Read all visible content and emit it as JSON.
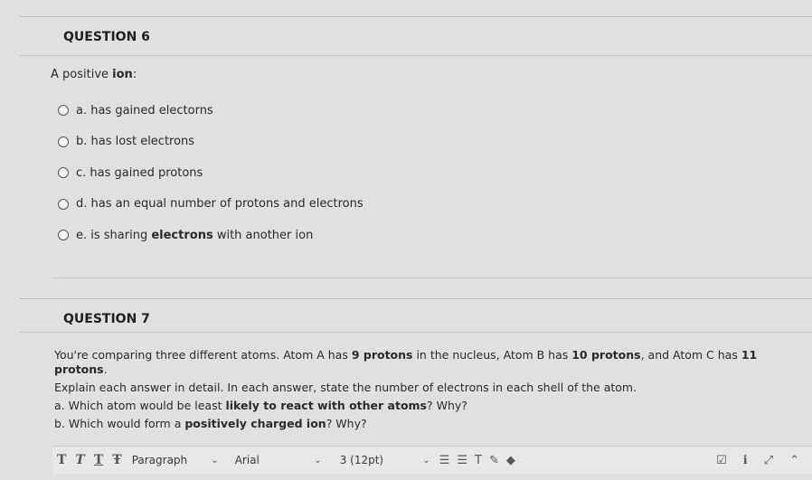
{
  "q6": {
    "title": "QUESTION 6",
    "prompt_plain": "A positive ",
    "prompt_bold": "ion",
    "prompt_end": ":",
    "answers": [
      {
        "label": "a. has gained electorns"
      },
      {
        "label": "b. has lost electrons"
      },
      {
        "label": "c. has gained protons"
      },
      {
        "label": "d. has an equal number of protons and electrons"
      },
      {
        "label_pre": "e. is sharing ",
        "label_bold": "electrons",
        "label_post": " with another ion"
      }
    ]
  },
  "q7": {
    "title": "QUESTION 7",
    "text1_a": "You're comparing three different atoms. Atom A has ",
    "text1_b": "9 protons",
    "text1_c": " in the nucleus, Atom B has ",
    "text1_d": "10 protons",
    "text1_e": ", and Atom C has ",
    "text1_f": "11 protons",
    "text1_g": ".",
    "text2": "Explain each answer in detail. In each answer, state the number of electrons in each shell of the atom.",
    "text3_a": "a. Which atom would be least ",
    "text3_b": "likely to react with other atoms",
    "text3_c": "? Why?",
    "text4_a": "b. Which would form a ",
    "text4_b": "positively charged ion",
    "text4_c": "? Why?"
  },
  "toolbar": {
    "format_buttons": [
      "T",
      "T",
      "T",
      "Ŧ"
    ],
    "paragraph": "Paragraph",
    "font": "Arial",
    "size": "3 (12pt)"
  }
}
